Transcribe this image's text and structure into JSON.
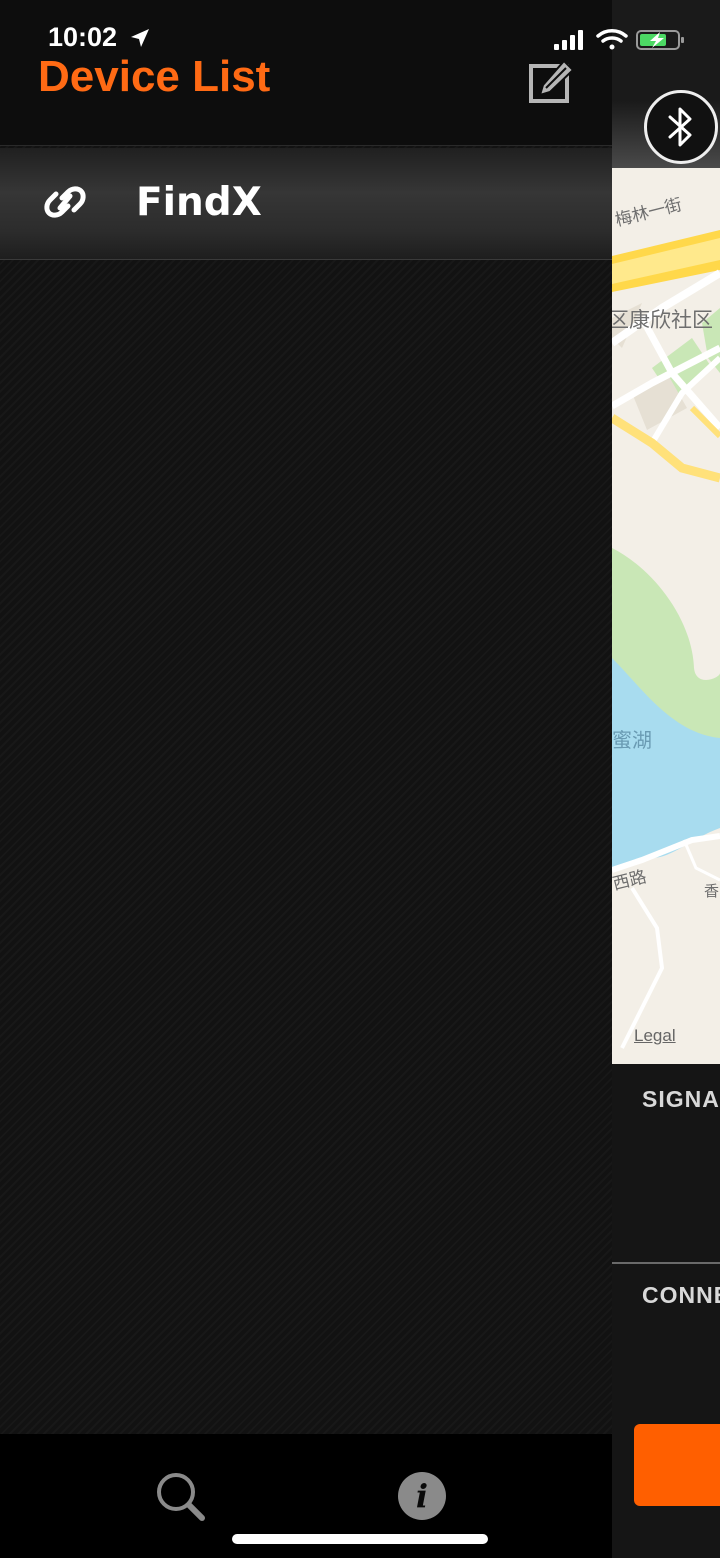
{
  "status_bar": {
    "time": "10:02"
  },
  "drawer": {
    "title": "Device List",
    "devices": [
      {
        "name": "FindX"
      }
    ]
  },
  "main": {
    "map": {
      "labels": [
        "梅林一街",
        "区康欣社区",
        "蜜湖",
        "西路",
        "香"
      ],
      "legal": "Legal"
    },
    "sections": [
      "SIGNA",
      "CONNE"
    ]
  },
  "colors": {
    "accent": "#ff6a14",
    "button": "#ff5f00",
    "water": "#a8dcef",
    "park": "#c9e7b6",
    "road": "#ffe17a"
  },
  "icons": {
    "edit": "edit-icon",
    "link": "link-icon",
    "bluetooth": "bluetooth-icon",
    "search": "search-icon",
    "info": "info-icon"
  }
}
